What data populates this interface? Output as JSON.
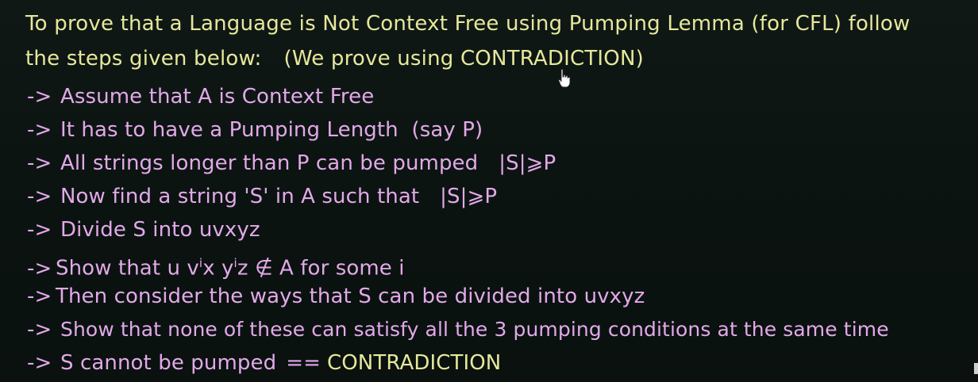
{
  "intro": {
    "line1": "To prove that a Language is Not Context Free using Pumping Lemma (for CFL) follow",
    "line2": "the steps given below:",
    "note": "(We prove using CONTRADICTION)"
  },
  "steps": [
    {
      "arrow": "->",
      "text": "Assume that A is Context Free"
    },
    {
      "arrow": "->",
      "text": "It has to have a Pumping Length  (say P)"
    },
    {
      "arrow": "->",
      "text": "All strings longer than P can be pumped",
      "math": "|S|⩾P"
    },
    {
      "arrow": "->",
      "text": "Now find a string 'S' in A such that",
      "math": "|S|⩾P"
    },
    {
      "arrow": "->",
      "text": "Divide S into uvxyz"
    },
    {
      "arrow": "->",
      "text_a": "Show that u v",
      "sup1": "i",
      "text_b": "x y",
      "sup2": "i",
      "text_c": "z ∉ A for some i"
    },
    {
      "arrow": "->",
      "text": "Then consider the ways that S can be divided into uvxyz"
    },
    {
      "arrow": "->",
      "text": "Show that none of these can satisfy all the 3 pumping conditions at the same time"
    },
    {
      "arrow": "->",
      "text": "S cannot be pumped",
      "eq": "==",
      "highlight": "CONTRADICTION"
    }
  ],
  "icons": {
    "cursor": "hand-pointer-icon"
  },
  "colors": {
    "background": "#0c1412",
    "intro_text": "#e6e89a",
    "step_text": "#e2a9e8"
  }
}
